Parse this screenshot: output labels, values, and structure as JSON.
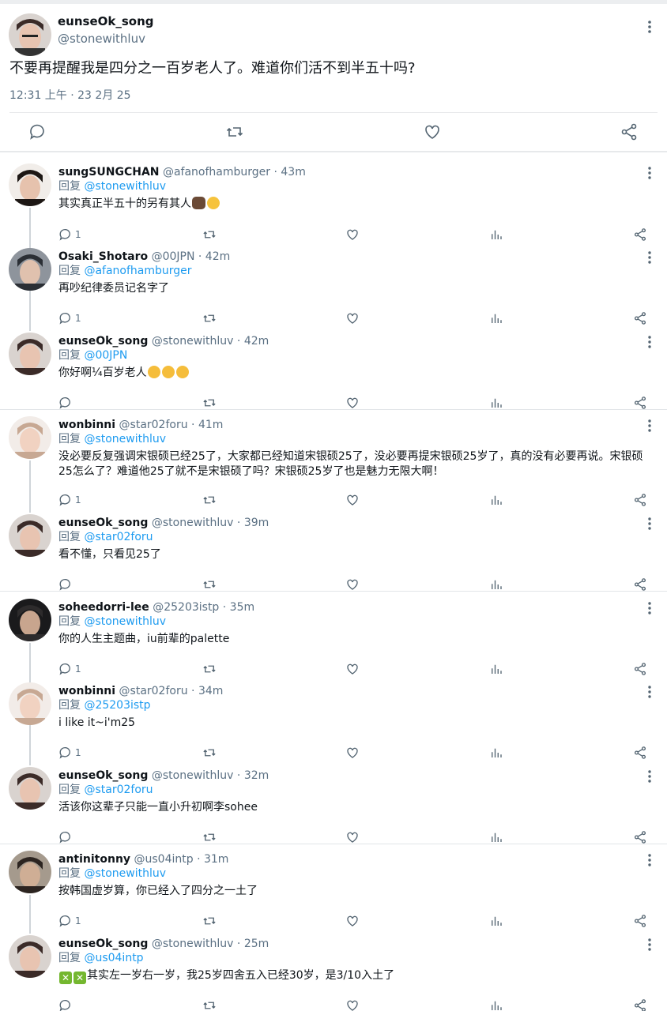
{
  "main_tweet": {
    "name": "eunseOk_song",
    "handle": "@stonewithluv",
    "text": "不要再提醒我是四分之一百岁老人了。难道你们活不到半五十吗?",
    "time": "12:31 上午 · 23 2月 25"
  },
  "reply_prefix": "回复",
  "replies": [
    {
      "name": "sungSUNGCHAN",
      "handle": "@afanofhamburger",
      "time": "· 43m",
      "reply_to": "@stonewithluv",
      "text": "其实真正半五十的另有其人",
      "emoji": [
        "dark-hand-emoji",
        "grinning-face-emoji"
      ],
      "reply_count": "1"
    },
    {
      "name": "Osaki_Shotaro",
      "handle": "@00JPN",
      "time": "· 42m",
      "reply_to": "@afanofhamburger",
      "text": "再吵纪律委员记名字了",
      "reply_count": "1"
    },
    {
      "name": "eunseOk_song",
      "handle": "@stonewithluv",
      "time": "· 42m",
      "reply_to": "@00JPN",
      "text": "你好啊¼百岁老人",
      "emoji": [
        "hugging-face-emoji",
        "hugging-face-emoji",
        "hugging-face-emoji"
      ],
      "reply_count": ""
    },
    {
      "name": "wonbinni",
      "handle": "@star02foru",
      "time": "· 41m",
      "reply_to": "@stonewithluv",
      "text": "没必要反复强调宋银硕已经25了，大家都已经知道宋银硕25了，没必要再提宋银硕25岁了，真的没有必要再说。宋银硕25怎么了？难道他25了就不是宋银硕了吗？宋银硕25岁了也是魅力无限大啊！",
      "reply_count": "1"
    },
    {
      "name": "eunseOk_song",
      "handle": "@stonewithluv",
      "time": "· 39m",
      "reply_to": "@star02foru",
      "text": "看不懂，只看见25了",
      "reply_count": ""
    },
    {
      "name": "soheedorri-lee",
      "handle": "@25203istp",
      "time": "· 35m",
      "reply_to": "@stonewithluv",
      "text": "你的人生主题曲，iu前辈的palette",
      "reply_count": "1"
    },
    {
      "name": "wonbinni",
      "handle": "@star02foru",
      "time": "· 34m",
      "reply_to": "@25203istp",
      "text": "i like it~i'm25",
      "reply_count": "1"
    },
    {
      "name": "eunseOk_song",
      "handle": "@stonewithluv",
      "time": "· 32m",
      "reply_to": "@star02foru",
      "text": "活该你这辈子只能一直小升初啊李sohee",
      "reply_count": ""
    },
    {
      "name": "antinitonny",
      "handle": "@us04intp",
      "time": "· 31m",
      "reply_to": "@stonewithluv",
      "text": "按韩国虚岁算，你已经入了四分之一土了",
      "reply_count": "1"
    },
    {
      "name": "eunseOk_song",
      "handle": "@stonewithluv",
      "time": "· 25m",
      "reply_to": "@us04intp",
      "text": "其实左一岁右一岁，我25岁四舍五入已经30岁，是3/10入土了",
      "emoji_prefix": [
        "cross-mark-emoji",
        "cross-mark-emoji"
      ],
      "reply_count": ""
    }
  ],
  "colors": {
    "link": "#1d9bf0",
    "secondary": "#5b7083",
    "text": "#0f1419",
    "divider": "#e7e9eb"
  }
}
